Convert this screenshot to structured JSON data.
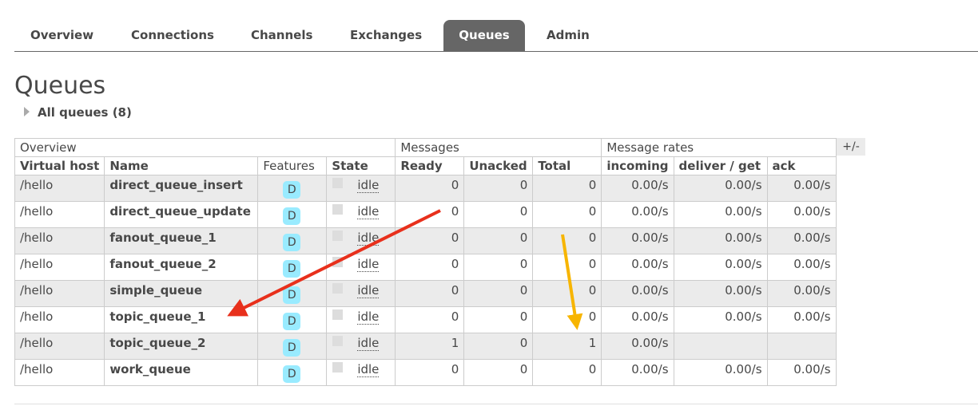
{
  "tabs": [
    {
      "label": "Overview"
    },
    {
      "label": "Connections"
    },
    {
      "label": "Channels"
    },
    {
      "label": "Exchanges"
    },
    {
      "label": "Queues",
      "active": true
    },
    {
      "label": "Admin"
    }
  ],
  "page_title": "Queues",
  "section_label": "All queues (8)",
  "table": {
    "group_headers": {
      "overview": "Overview",
      "messages": "Messages",
      "message_rates": "Message rates"
    },
    "columns": [
      "Virtual host",
      "Name",
      "Features",
      "State",
      "Ready",
      "Unacked",
      "Total",
      "incoming",
      "deliver / get",
      "ack"
    ],
    "rows": [
      {
        "vhost": "/hello",
        "name": "direct_queue_insert",
        "feature": "D",
        "state": "idle",
        "ready": "0",
        "unacked": "0",
        "total": "0",
        "incoming": "0.00/s",
        "deliver_get": "0.00/s",
        "ack": "0.00/s"
      },
      {
        "vhost": "/hello",
        "name": "direct_queue_update",
        "feature": "D",
        "state": "idle",
        "ready": "0",
        "unacked": "0",
        "total": "0",
        "incoming": "0.00/s",
        "deliver_get": "0.00/s",
        "ack": "0.00/s"
      },
      {
        "vhost": "/hello",
        "name": "fanout_queue_1",
        "feature": "D",
        "state": "idle",
        "ready": "0",
        "unacked": "0",
        "total": "0",
        "incoming": "0.00/s",
        "deliver_get": "0.00/s",
        "ack": "0.00/s"
      },
      {
        "vhost": "/hello",
        "name": "fanout_queue_2",
        "feature": "D",
        "state": "idle",
        "ready": "0",
        "unacked": "0",
        "total": "0",
        "incoming": "0.00/s",
        "deliver_get": "0.00/s",
        "ack": "0.00/s"
      },
      {
        "vhost": "/hello",
        "name": "simple_queue",
        "feature": "D",
        "state": "idle",
        "ready": "0",
        "unacked": "0",
        "total": "0",
        "incoming": "0.00/s",
        "deliver_get": "0.00/s",
        "ack": "0.00/s"
      },
      {
        "vhost": "/hello",
        "name": "topic_queue_1",
        "feature": "D",
        "state": "idle",
        "ready": "0",
        "unacked": "0",
        "total": "0",
        "incoming": "0.00/s",
        "deliver_get": "0.00/s",
        "ack": "0.00/s"
      },
      {
        "vhost": "/hello",
        "name": "topic_queue_2",
        "feature": "D",
        "state": "idle",
        "ready": "1",
        "unacked": "0",
        "total": "1",
        "incoming": "0.00/s",
        "deliver_get": "",
        "ack": ""
      },
      {
        "vhost": "/hello",
        "name": "work_queue",
        "feature": "D",
        "state": "idle",
        "ready": "0",
        "unacked": "0",
        "total": "0",
        "incoming": "0.00/s",
        "deliver_get": "0.00/s",
        "ack": "0.00/s"
      }
    ]
  },
  "column_toggle_label": "+/-",
  "colors": {
    "active_tab": "#666666",
    "badge": "#99ebff",
    "row_alt": "#ebebeb",
    "arrow_red": "#e8301c",
    "arrow_yellow": "#f7b500"
  }
}
